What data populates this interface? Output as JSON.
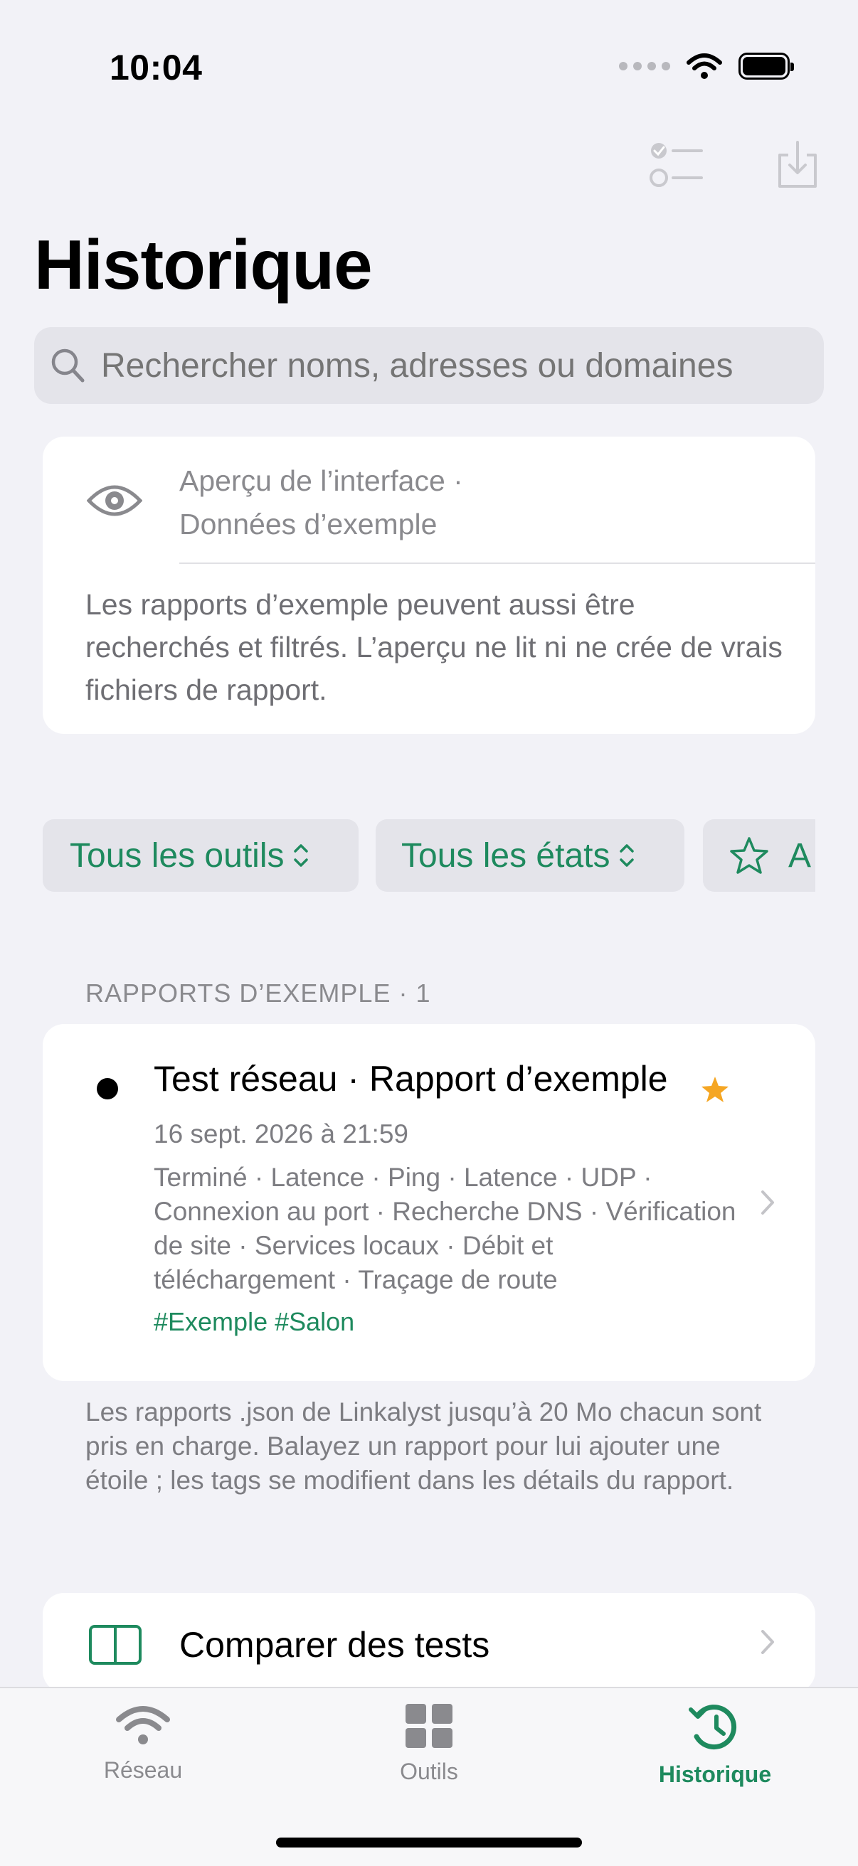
{
  "status_bar": {
    "time": "10:04"
  },
  "toolbar": {
    "select_icon": "checklist-icon",
    "import_icon": "tray-download-icon"
  },
  "page": {
    "title": "Historique"
  },
  "search": {
    "placeholder": "Rechercher noms, adresses ou domaines",
    "value": ""
  },
  "preview": {
    "icon": "eye-icon",
    "title_line1": "Aperçu de l’interface ·",
    "title_line2": "Données d’exemple",
    "body": "Les rapports d’exemple peuvent aussi être recherchés et filtrés. L’aperçu ne lit ni ne crée de vrais fichiers de rapport."
  },
  "filters": {
    "tools": "Tous les outils",
    "states": "Tous les états",
    "third": "A"
  },
  "section": {
    "label": "RAPPORTS D’EXEMPLE · 1"
  },
  "report": {
    "title": "Test réseau · Rapport d’exemple",
    "starred": true,
    "date": "16 sept. 2026 à 21:59",
    "tools": "Terminé · Latence · Ping · Latence · UDP · Connexion au port · Recherche DNS · Vérification de site · Services locaux · Débit et téléchargement · Traçage de route",
    "tags": "#Exemple #Salon"
  },
  "footnote": "Les rapports .json de Linkalyst jusqu’à 20 Mo chacun sont pris en charge. Balayez un rapport pour lui ajouter une étoile ; les tags se modifient dans les détails du rapport.",
  "compare": {
    "label": "Comparer des tests"
  },
  "tabs": [
    {
      "label": "Réseau",
      "icon": "wifi-icon",
      "active": false
    },
    {
      "label": "Outils",
      "icon": "grid-icon",
      "active": false
    },
    {
      "label": "Historique",
      "icon": "history-icon",
      "active": true
    }
  ],
  "colors": {
    "accent": "#1e8a5e",
    "star": "#f5a623",
    "background": "#f2f2f7"
  }
}
